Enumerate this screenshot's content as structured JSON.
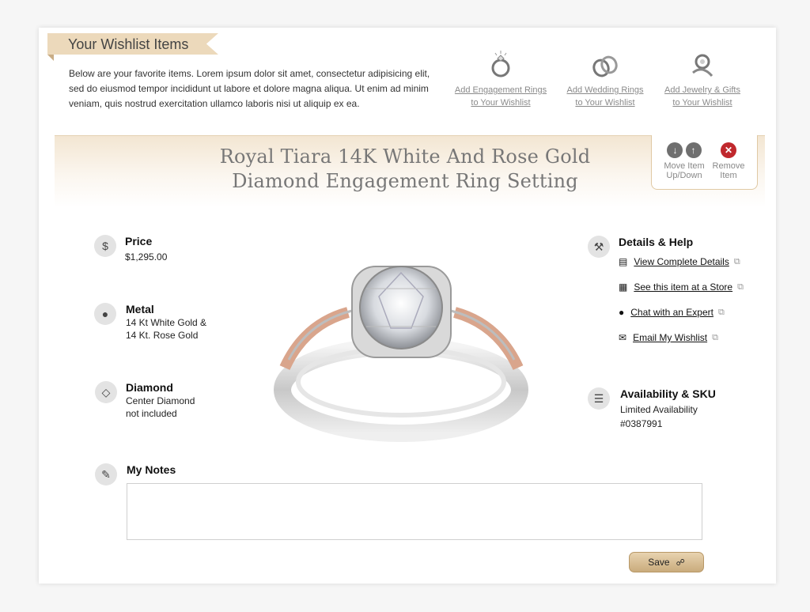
{
  "header": {
    "title": "Your Wishlist Items",
    "intro": "Below are your favorite items.  Lorem ipsum dolor sit amet, consectetur adipisicing elit, sed do eiusmod tempor incididunt ut labore et dolore magna aliqua. Ut enim ad minim veniam, quis nostrud exercitation ullamco laboris nisi ut aliquip ex ea."
  },
  "add_links": [
    {
      "label": "Add Engagement Rings\nto Your Wishlist",
      "icon": "engagement-ring-icon"
    },
    {
      "label": "Add Wedding Rings\nto Your Wishlist",
      "icon": "wedding-rings-icon"
    },
    {
      "label": "Add Jewelry & Gifts\nto Your Wishlist",
      "icon": "jewelry-gifts-icon"
    }
  ],
  "item": {
    "title_line1": "Royal Tiara 14K White And Rose Gold",
    "title_line2": "Diamond Engagement Ring Setting"
  },
  "controls": {
    "move_label": "Move Item\nUp/Down",
    "remove_label": "Remove\nItem"
  },
  "specs": {
    "price_label": "Price",
    "price_value": "$1,295.00",
    "metal_label": "Metal",
    "metal_value_1": "14 Kt White Gold &",
    "metal_value_2": "14 Kt. Rose Gold",
    "diamond_label": "Diamond",
    "diamond_value_1": "Center Diamond",
    "diamond_value_2": "not included"
  },
  "help": {
    "heading": "Details & Help",
    "links": [
      "View Complete Details",
      "See this item at a Store",
      "Chat with an Expert",
      "Email My Wishlist"
    ]
  },
  "availability": {
    "heading": "Availability & SKU",
    "status": "Limited Availability",
    "sku": "#0387991"
  },
  "notes": {
    "heading": "My Notes",
    "value": ""
  },
  "save_label": "Save",
  "colors": {
    "accent_tan": "#ecd9bb",
    "remove_red": "#c0282d",
    "move_gray": "#6f6f6f"
  }
}
